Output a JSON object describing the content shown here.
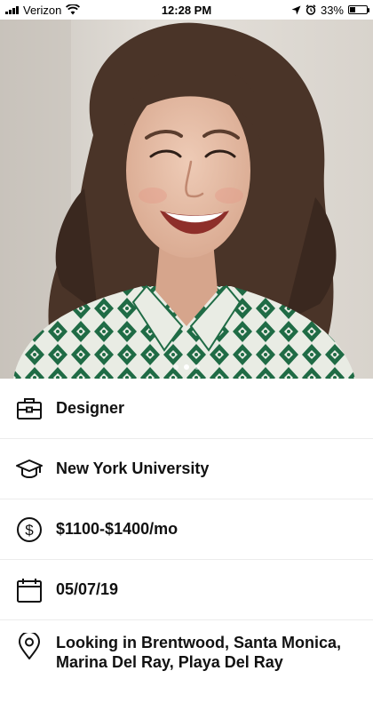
{
  "status_bar": {
    "carrier": "Verizon",
    "time": "12:28 PM",
    "battery_percent": "33%",
    "battery_level": 0.33,
    "icons": [
      "signal-icon",
      "wifi-icon",
      "location-arrow-icon",
      "alarm-icon",
      "battery-icon"
    ]
  },
  "photo": {
    "pages": 3,
    "active_page": 1
  },
  "details": [
    {
      "icon": "briefcase-icon",
      "label": "Designer"
    },
    {
      "icon": "graduation-cap-icon",
      "label": "New York University"
    },
    {
      "icon": "dollar-icon",
      "label": "$1100-$1400/mo"
    },
    {
      "icon": "calendar-icon",
      "label": "05/07/19"
    },
    {
      "icon": "location-pin-icon",
      "label": "Looking in Brentwood, Santa Monica, Marina Del Ray, Playa Del Ray"
    }
  ],
  "colors": {
    "accent_green": "#1f6b45",
    "text": "#111111",
    "divider": "#ececec"
  }
}
